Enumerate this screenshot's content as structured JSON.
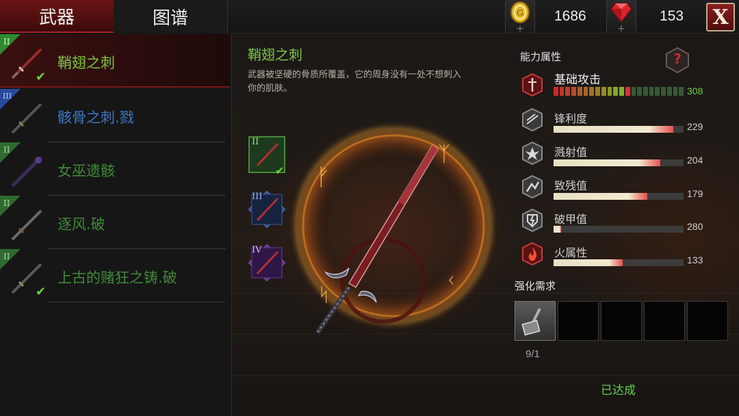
{
  "tabs": [
    {
      "label": "武器",
      "active": true
    },
    {
      "label": "图谱",
      "active": false
    }
  ],
  "currency": {
    "gold": {
      "icon": "gold-coin-icon",
      "value": "1686"
    },
    "gems": {
      "icon": "red-gem-icon",
      "value": "153"
    }
  },
  "close_label": "X",
  "weapons": [
    {
      "name": "鞘翅之刺",
      "tier": "II",
      "tier_color": "#2f8a2f",
      "name_color": "#7cc63c",
      "selected": true,
      "checked": true
    },
    {
      "name": "骸骨之刺.戮",
      "tier": "III",
      "tier_color": "#2a4aa0",
      "name_color": "#3a78c8",
      "selected": false,
      "checked": false
    },
    {
      "name": "女巫遗骸",
      "tier": "II",
      "tier_color": "#2f6a2f",
      "name_color": "#3f8a36",
      "selected": false,
      "checked": false
    },
    {
      "name": "逐风.破",
      "tier": "II",
      "tier_color": "#2f6a2f",
      "name_color": "#3f8a36",
      "selected": false,
      "checked": false
    },
    {
      "name": "上古的赌狂之铸.破",
      "tier": "II",
      "tier_color": "#2f6a2f",
      "name_color": "#3f8a36",
      "selected": false,
      "checked": true
    }
  ],
  "detail": {
    "title": "鞘翅之刺",
    "description": "武器被坚硬的骨质所覆盖，它的周身没有一处不想刺入你的肌肤。",
    "tiers": [
      {
        "label": "II",
        "color": "#2c5a2c",
        "text_color": "#9fe08a",
        "checked": true,
        "active": true
      },
      {
        "label": "III",
        "color": "#1d2f5c",
        "text_color": "#9bb6f0",
        "checked": false,
        "active": false
      },
      {
        "label": "IV",
        "color": "#3e1f5e",
        "text_color": "#d6b8f2",
        "checked": false,
        "active": false
      }
    ]
  },
  "attributes": {
    "section_label": "能力属性",
    "help_label": "?",
    "base_attack": {
      "name": "基础攻击",
      "value": "308",
      "icon": "sword-shield-icon",
      "fill": 0.6
    },
    "stats": [
      {
        "name": "锋利度",
        "value": "229",
        "icon": "sharpness-icon",
        "fill": 0.92
      },
      {
        "name": "溅射值",
        "value": "204",
        "icon": "splash-icon",
        "fill": 0.82
      },
      {
        "name": "致残值",
        "value": "179",
        "icon": "cripple-icon",
        "fill": 0.72
      },
      {
        "name": "破甲值",
        "value": "280",
        "icon": "armor-break-icon",
        "fill": 0.06
      },
      {
        "name": "火属性",
        "value": "133",
        "icon": "fire-icon",
        "fill": 0.53
      }
    ]
  },
  "requirements": {
    "section_label": "强化需求",
    "count": "9/1",
    "status": "已达成"
  }
}
